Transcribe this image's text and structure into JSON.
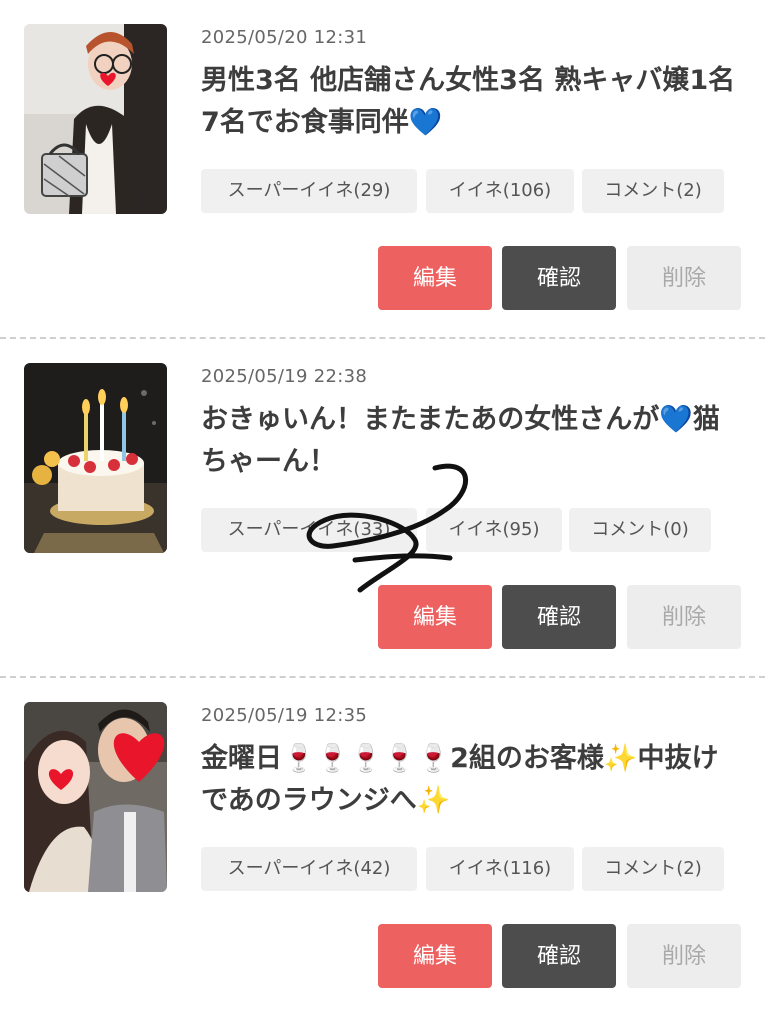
{
  "posts": [
    {
      "date": "2025/05/20 12:31",
      "title_parts": [
        "男性3名 他店舗さん女性3名 熟キャバ嬢1名 7名でお食事同伴",
        "💙",
        ""
      ],
      "chips": [
        "スーパーイイネ(29)",
        "イイネ(106)",
        "コメント(2)"
      ]
    },
    {
      "date": "2025/05/19 22:38",
      "title_parts": [
        "おきゅいん！またまたあの女性さんが",
        "💙",
        "猫ちゃーん！"
      ],
      "chips": [
        "スーパーイイネ(33)",
        "イイネ(95)",
        "コメント(0)"
      ]
    },
    {
      "date": "2025/05/19 12:35",
      "title_parts": [
        "金曜日",
        "🍷🍷🍷🍷🍷",
        "2組のお客様",
        "✨",
        "中抜けであのラウンジへ",
        "✨"
      ],
      "chips": [
        "スーパーイイネ(42)",
        "イイネ(116)",
        "コメント(2)"
      ]
    }
  ],
  "buttons": {
    "edit": "編集",
    "confirm": "確認",
    "delete": "削除"
  },
  "colors": {
    "edit": "#ee6161",
    "confirm": "#4d4d4d",
    "delete": "#ededed",
    "chip": "#f0f0f0"
  }
}
